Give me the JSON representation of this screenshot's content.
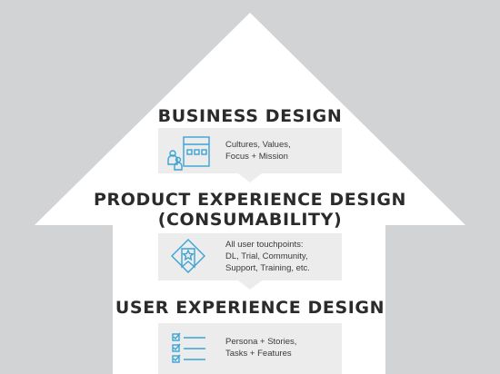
{
  "colors": {
    "background": "#d2d3d5",
    "arrow": "#ffffff",
    "card": "#ececec",
    "icon": "#3aa3d6",
    "heading": "#2b2b2b"
  },
  "sections": [
    {
      "heading": [
        "BUSINESS DESIGN"
      ],
      "icon": "people-grid-icon",
      "text": [
        "Cultures, Values,",
        "Focus + Mission"
      ]
    },
    {
      "heading": [
        "PRODUCT EXPERIENCE DESIGN",
        "(CONSUMABILITY)"
      ],
      "icon": "badge-star-icon",
      "text": [
        "All user touchpoints:",
        "DL, Trial, Community,",
        "Support, Training, etc."
      ]
    },
    {
      "heading": [
        "USER EXPERIENCE DESIGN"
      ],
      "icon": "checklist-icon",
      "text": [
        "Persona + Stories,",
        "Tasks + Features"
      ]
    }
  ]
}
